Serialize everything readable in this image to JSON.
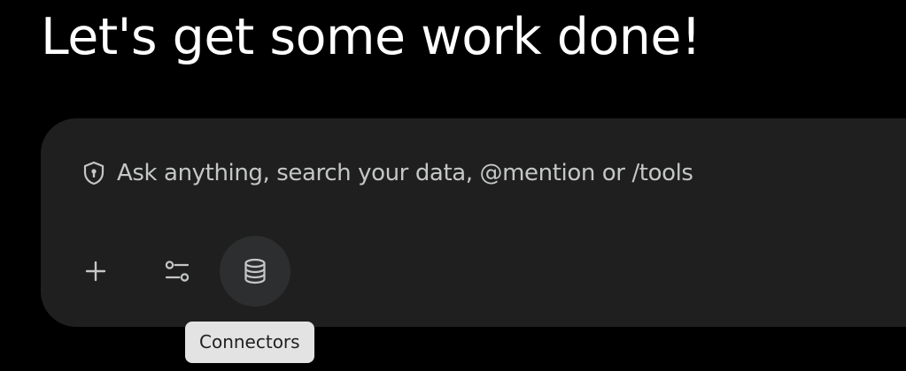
{
  "greeting": {
    "title": "Let's get some work done!"
  },
  "composer": {
    "placeholder": "Ask anything, search your data, @mention or /tools",
    "privacy_icon": "shield-lock-icon",
    "tools": [
      {
        "icon": "plus-icon"
      },
      {
        "icon": "tune-icon"
      },
      {
        "icon": "database-icon"
      }
    ]
  },
  "tooltip": {
    "label": "Connectors"
  },
  "colors": {
    "background": "#000000",
    "composer_bg": "#1f1f1f",
    "text_primary": "#ffffff",
    "text_secondary": "#c4c7c5",
    "hover_circle": "#2d2e2f",
    "tooltip_bg": "#e3e3e3"
  }
}
